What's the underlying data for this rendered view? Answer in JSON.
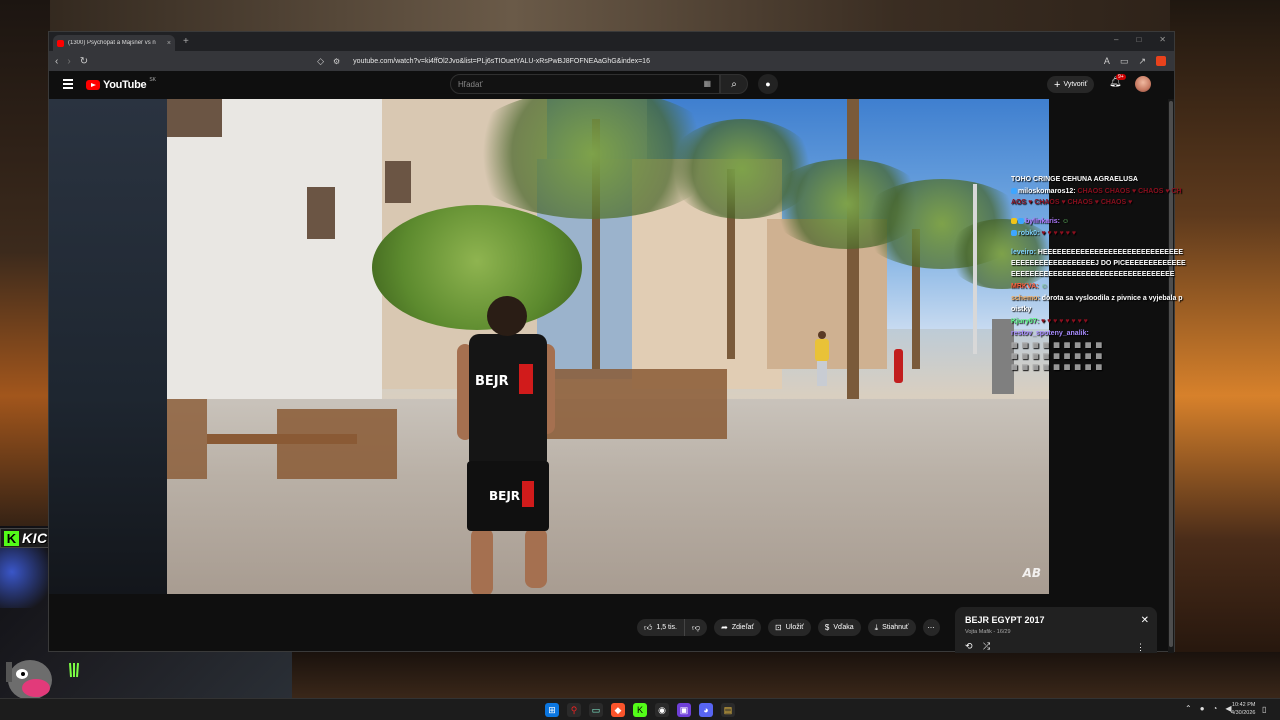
{
  "stream_overlay": {
    "kick_label": "KICK.COM/RESTT",
    "kick_letter": "K"
  },
  "browser": {
    "tab_title": "(1300) Psychopat a Majsner vs n",
    "tab_close": "×",
    "new_tab": "+",
    "url": "youtube.com/watch?v=ki4ffOl2Jvo&list=PLj6sTIOuetYALU-xRsPwBJ8FOFNEAaGhG&index=16",
    "window_controls": [
      "–",
      "□",
      "✕"
    ]
  },
  "youtube": {
    "logo_text": "YouTube",
    "country_code": "SK",
    "search_placeholder": "Hľadať",
    "create_label": "Vytvoriť",
    "notification_badge": "9+"
  },
  "video": {
    "shirt_text": "BEJR",
    "shorts_text": "BEJR",
    "watermark": "AB"
  },
  "chat": {
    "messages": [
      {
        "user": "",
        "text": "TOHO CRINGE CEHUNA AGRAELUSA"
      },
      {
        "user": "miloskomaros12:",
        "text": "CHAOS CHAOS ♥ CHAOS ♥ CHAOS ♥ CHAOS ♥ CHAOS ♥ CHAOS ♥"
      },
      {
        "user": "bylinkaris:",
        "text": "☺"
      },
      {
        "user": "robk0:",
        "text": "♥ ♥ ♥ ♥ ♥ ♥"
      },
      {
        "user": "leveiro:",
        "text": "HEEEEEEEEEEEEEEEEEEEEEEEEEEEEEEEEEEEEEEEEEEEEEEEEJ DO PICEEEEEEEEEEEEEEEEEEEEEEEEEEEEEEEEEEEEEEEEEEEEEEEE"
      },
      {
        "user": "MRKVA:",
        "text": "☺"
      },
      {
        "user": "schemo:",
        "text": "dorota sa vysloodila z pivnice a vyjebala poistky"
      },
      {
        "user": "Kjury07:",
        "text": "♥ ♥ ♥ ♥ ♥ ♥ ♥ ♥"
      },
      {
        "user": "restov_spoteny_analik:",
        "text": ""
      }
    ]
  },
  "actions": {
    "like_count": "1,5 tis.",
    "share_label": "Zdieľať",
    "save_label": "Uložiť",
    "thanks_label": "Vďaka",
    "download_label": "Stiahnuť",
    "more_label": "⋯"
  },
  "playlist": {
    "title": "BEJR EGYPT 2017",
    "subtitle": "Vojta Mafik - 16/29",
    "close": "✕",
    "loop_icon": "⟲",
    "shuffle_icon": "⤮",
    "more": "⋮"
  },
  "taskbar": {
    "time": "10:42 PM",
    "date": "4/30/2026"
  }
}
